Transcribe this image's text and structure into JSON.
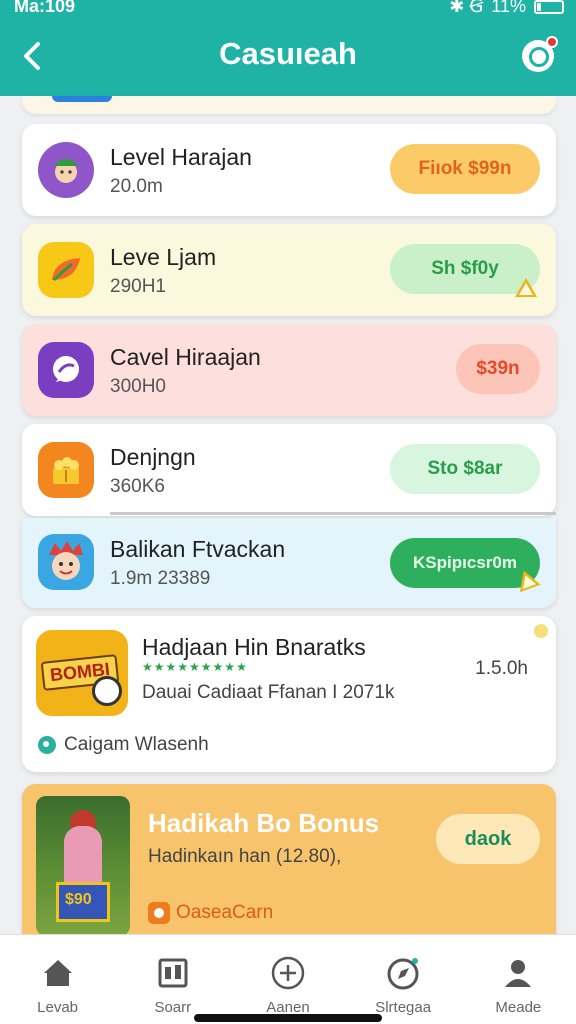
{
  "status": {
    "time": "Ma:109",
    "icons": "✱ Ꞡ",
    "battery": "11%"
  },
  "header": {
    "title": "Casuıeah",
    "back_icon": "chevron-left-icon",
    "notif_icon": "bell-icon"
  },
  "rows": [
    {
      "name": "Level Harajan",
      "sub": "20.0m",
      "pill": "Fiıok $99n",
      "pill_bg": "#fbcb6a",
      "pill_fg": "#e0641a"
    },
    {
      "name": "Leve Ljam",
      "sub": "290H1",
      "pill": "Sh $f0y",
      "pill_bg": "#c9f0c9",
      "pill_fg": "#2a9d4a"
    },
    {
      "name": "Cavel Hiraajan",
      "sub": "300H0",
      "pill": "$39n",
      "pill_bg": "#fcc5b8",
      "pill_fg": "#e5492b"
    },
    {
      "name": "Denjngn",
      "sub": "360K6",
      "pill": "Sto $8ar",
      "pill_bg": "#d8f6df",
      "pill_fg": "#2a9d4a"
    },
    {
      "name": "Balikan Ftvackan",
      "sub": "1.9m  23389",
      "pill": "KSpipıcsr0m",
      "pill_bg": "#2eaf5e",
      "pill_fg": "#e8ffe8"
    }
  ],
  "feature": {
    "name": "Hadjaan Hin Bnaratks",
    "stars": "★★★★★★★★★",
    "sub": "Dauai Cadiaat Ffanan I 2071k",
    "value": "1.5.0h",
    "tagline": "Caigam Wlasenh",
    "thumb_label": "BOMBI"
  },
  "bonus": {
    "title": "Hadikah Bo Bonus",
    "sub": "Hadinkaın han (12.80),",
    "button": "daok",
    "link": "OaseaCarn",
    "board_label": "$90"
  },
  "nav": [
    {
      "label": "Levab",
      "icon": "home-icon"
    },
    {
      "label": "Soarr",
      "icon": "calendar-icon"
    },
    {
      "label": "Aanen",
      "icon": "plus-circle-icon"
    },
    {
      "label": "Slrtegaa",
      "icon": "compass-icon"
    },
    {
      "label": "Meade",
      "icon": "profile-icon"
    }
  ],
  "colors": {
    "primary": "#1fb3a6",
    "bonus": "#f8c46b"
  }
}
